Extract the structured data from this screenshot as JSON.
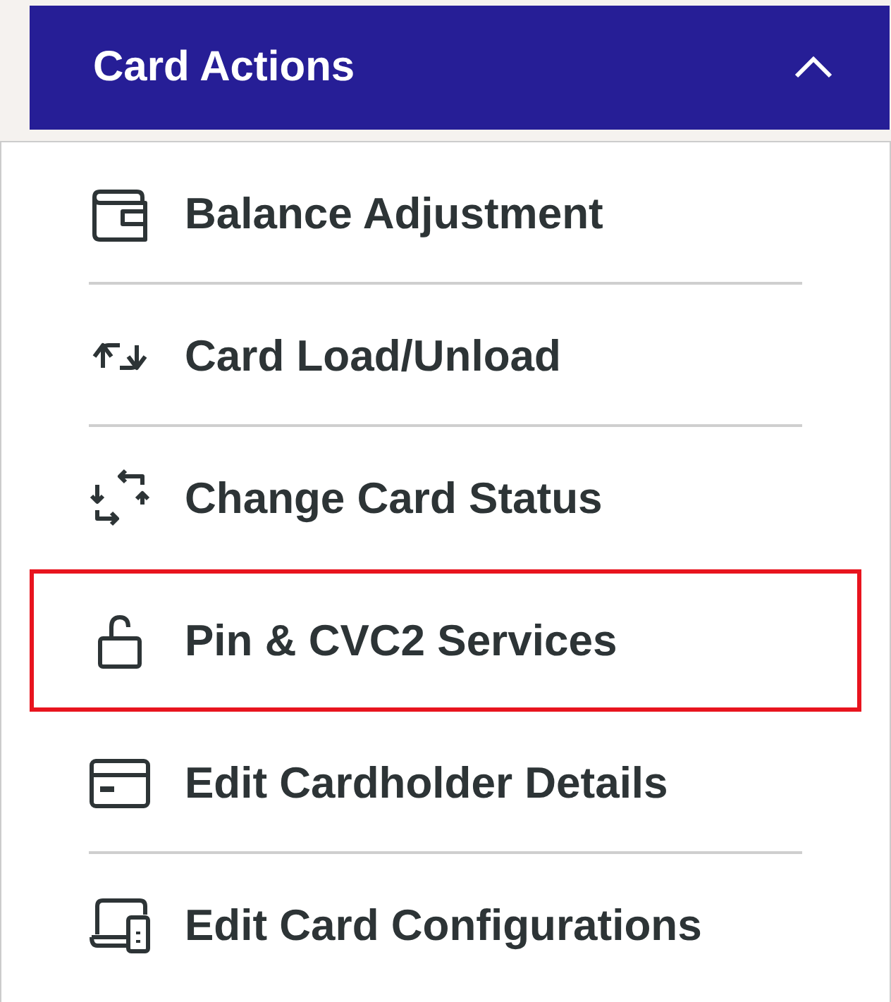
{
  "header": {
    "title": "Card Actions",
    "expanded": true
  },
  "items": [
    {
      "label": "Balance Adjustment",
      "kind": "wallet",
      "highlighted": false
    },
    {
      "label": "Card Load/Unload",
      "kind": "swap",
      "highlighted": false
    },
    {
      "label": "Change Card Status",
      "kind": "cycle",
      "highlighted": false
    },
    {
      "label": "Pin & CVC2 Services",
      "kind": "lock",
      "highlighted": true
    },
    {
      "label": "Edit Cardholder Details",
      "kind": "card",
      "highlighted": false
    },
    {
      "label": "Edit Card Configurations",
      "kind": "devices",
      "highlighted": false
    }
  ]
}
